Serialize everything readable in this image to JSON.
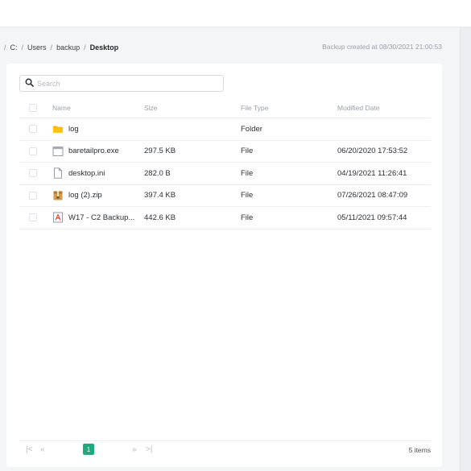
{
  "breadcrumb": {
    "items": [
      "C:",
      "Users",
      "backup",
      "Desktop"
    ],
    "separator": "/"
  },
  "backup_note": "Backup created at 08/30/2021 21:00:53",
  "search": {
    "placeholder": "Search",
    "value": ""
  },
  "table": {
    "headers": {
      "name": "Name",
      "size": "Size",
      "type": "File Type",
      "modified": "Modified Date"
    },
    "rows": [
      {
        "name": "log",
        "size": "",
        "type": "Folder",
        "modified": "",
        "icon": "folder-icon"
      },
      {
        "name": "baretailpro.exe",
        "size": "297.5 KB",
        "type": "File",
        "modified": "06/20/2020 17:53:52",
        "icon": "exe-file-icon"
      },
      {
        "name": "desktop.ini",
        "size": "282.0 B",
        "type": "File",
        "modified": "04/19/2021 11:26:41",
        "icon": "file-icon"
      },
      {
        "name": "log (2).zip",
        "size": "397.4 KB",
        "type": "File",
        "modified": "07/26/2021 08:47:09",
        "icon": "zip-file-icon"
      },
      {
        "name": "W17 - C2 Backup...",
        "size": "442.6 KB",
        "type": "File",
        "modified": "05/11/2021 09:57:44",
        "icon": "pdf-file-icon"
      }
    ]
  },
  "pagination": {
    "first": "|<",
    "prev": "«",
    "current_page": "1",
    "next": "»",
    "last": ">|",
    "items_count": "5 items"
  },
  "colors": {
    "accent": "#1eaa7e",
    "folder": "#f5b400",
    "pdf": "#d9352b"
  }
}
